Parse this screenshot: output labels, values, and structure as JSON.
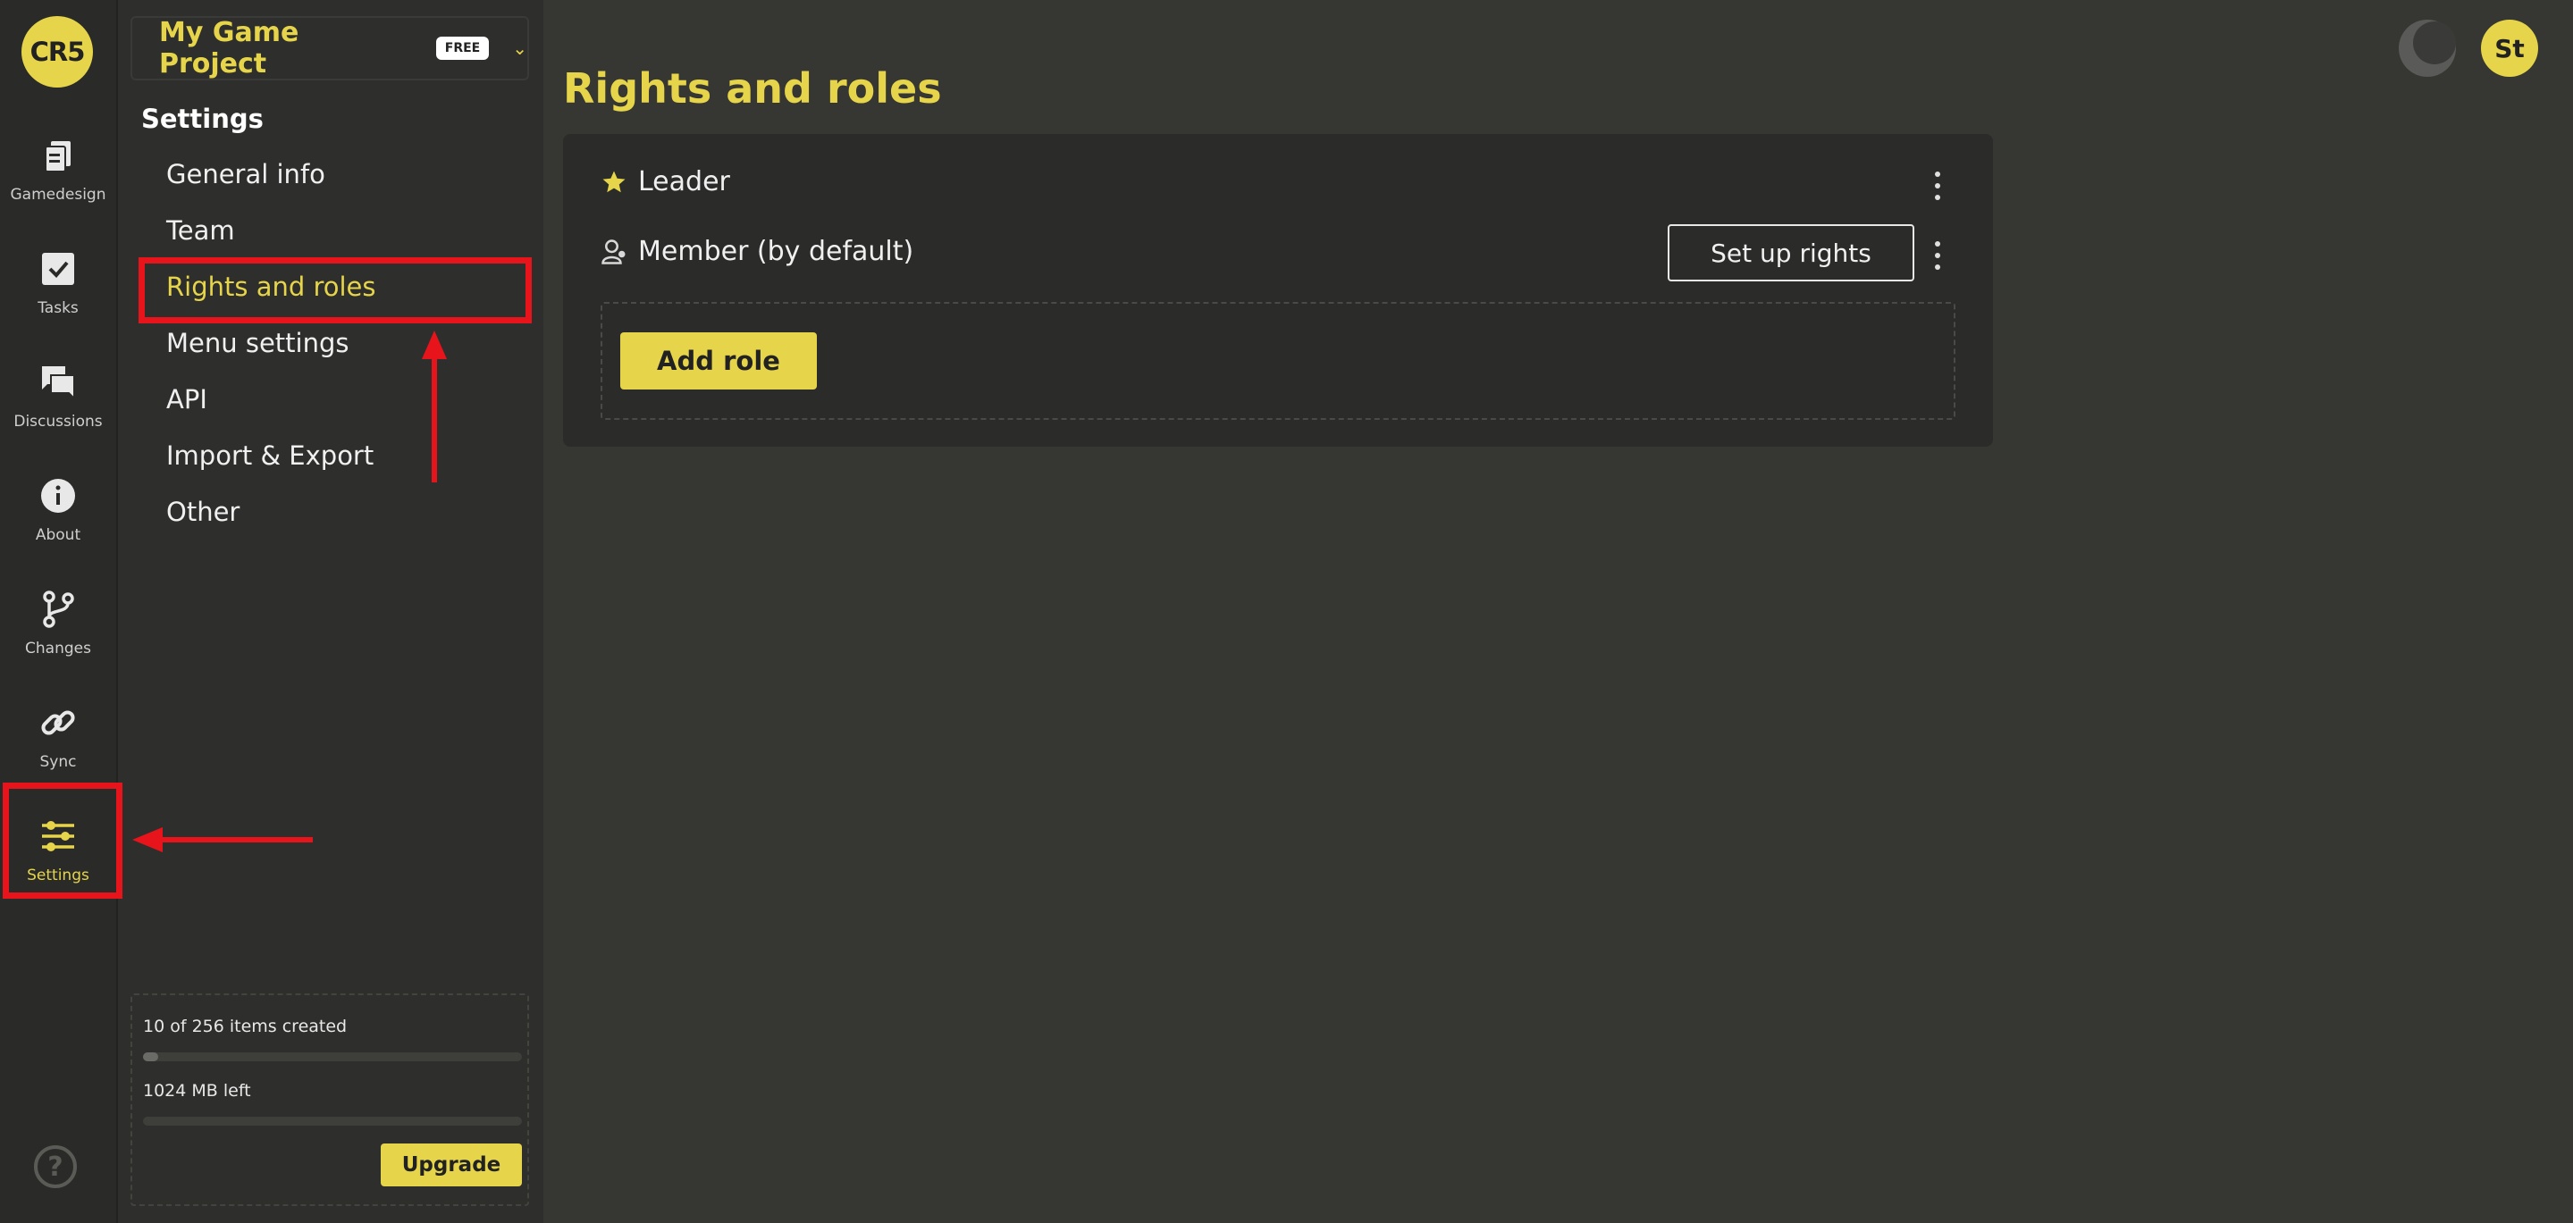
{
  "app": {
    "logo_text": "CR5",
    "accent": "#e6d54a",
    "annotation": "#e8141c"
  },
  "rail": {
    "items": [
      {
        "label": "Gamedesign",
        "icon": "documents-icon"
      },
      {
        "label": "Tasks",
        "icon": "checkbox-icon"
      },
      {
        "label": "Discussions",
        "icon": "chat-icon"
      },
      {
        "label": "About",
        "icon": "info-icon"
      },
      {
        "label": "Changes",
        "icon": "branch-icon"
      },
      {
        "label": "Sync",
        "icon": "link-icon"
      },
      {
        "label": "Settings",
        "icon": "sliders-icon",
        "active": true
      }
    ],
    "help": "?"
  },
  "project": {
    "name": "My Game Project",
    "plan_badge": "FREE"
  },
  "settings_nav": {
    "title": "Settings",
    "items": [
      {
        "label": "General info"
      },
      {
        "label": "Team"
      },
      {
        "label": "Rights and roles",
        "active": true
      },
      {
        "label": "Menu settings"
      },
      {
        "label": "API"
      },
      {
        "label": "Import & Export"
      },
      {
        "label": "Other"
      }
    ]
  },
  "usage": {
    "items_text": "10 of 256 items created",
    "items_fraction": 0.04,
    "storage_text": "1024 MB left",
    "storage_fraction": 0.0,
    "upgrade_label": "Upgrade"
  },
  "user": {
    "initials": "St"
  },
  "main": {
    "title": "Rights and roles",
    "roles": [
      {
        "name": "Leader",
        "icon": "star-icon"
      },
      {
        "name": "Member (by default)",
        "icon": "user-icon",
        "action": "Set up rights"
      }
    ],
    "add_role_label": "Add role"
  }
}
